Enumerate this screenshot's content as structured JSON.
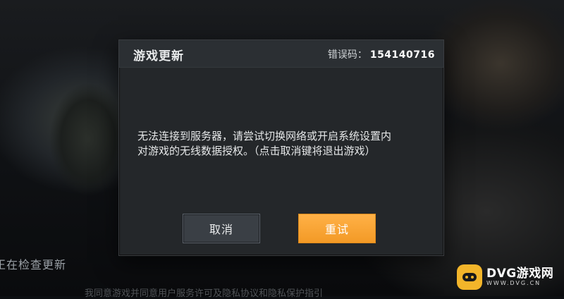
{
  "dialog": {
    "title": "游戏更新",
    "error_label": "错误码：",
    "error_code": "154140716",
    "message_lines": [
      "无法连接到服务器，请尝试切换网络或开启系统设置内",
      "对游戏的无线数据授权。（点击取消键将退出游戏）"
    ],
    "cancel_label": "取消",
    "retry_label": "重试"
  },
  "background": {
    "status_text": "正在检查更新",
    "bottom_text": "我同意游戏并同意用户服务许可及隐私协议和隐私保护指引"
  },
  "watermark": {
    "brand": "DVG游戏网",
    "url": "WWW.DVG.CN"
  },
  "colors": {
    "accent": "#f39a26",
    "dialog_bg": "#24272a"
  }
}
